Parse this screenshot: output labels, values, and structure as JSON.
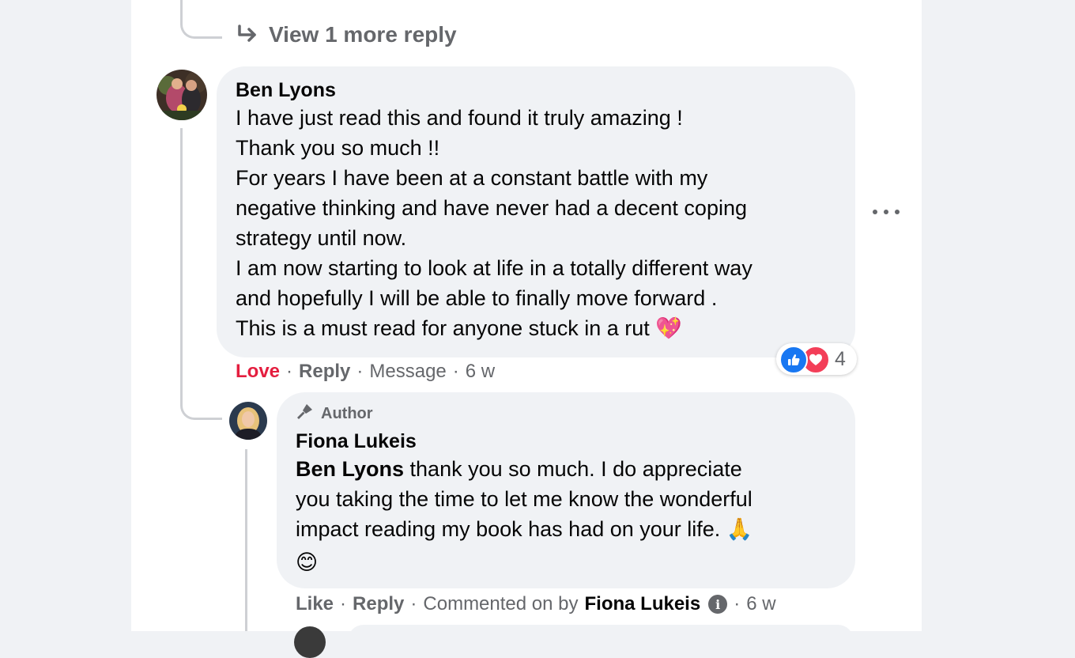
{
  "thread": {
    "view_more_label": "View 1 more reply"
  },
  "comment": {
    "author": "Ben Lyons",
    "lines": [
      "I have just read this and found it truly amazing !",
      "Thank you so much !!",
      "For years I have been at a constant battle with my",
      "negative thinking and have never had a decent coping",
      "strategy until now.",
      "I am now starting to look at life in a totally different way",
      "and hopefully I will be able to finally move forward .",
      "This is a must read for anyone stuck in a rut"
    ],
    "emoji_end": "💖",
    "reactions": {
      "count": "4",
      "icons": [
        "like-icon",
        "love-icon"
      ],
      "colors": {
        "like": "#1877f2",
        "love": "#f33e58"
      }
    },
    "actions": {
      "love": "Love",
      "reply": "Reply",
      "message": "Message",
      "time": "6 w"
    }
  },
  "reply": {
    "badge": "Author",
    "author": "Fiona Lukeis",
    "mention": "Ben Lyons",
    "lines": [
      " thank you so much. I do appreciate",
      "you taking the time to let me know the wonderful",
      "impact reading my book has had on your life. "
    ],
    "emoji_pray": "🙏",
    "emoji_smile": "😊",
    "actions": {
      "like": "Like",
      "reply": "Reply",
      "commented_on_by": "Commented on by",
      "commenter": "Fiona Lukeis",
      "time": "6 w"
    }
  }
}
